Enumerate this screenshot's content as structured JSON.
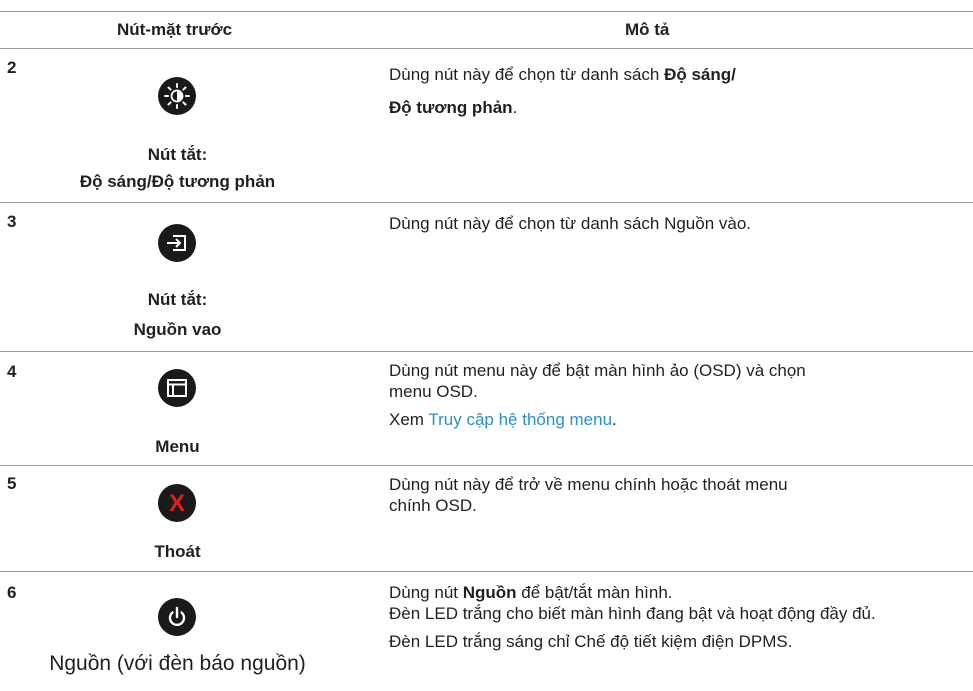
{
  "header": {
    "col1": "Nút-mặt trước",
    "col2": "Mô tả"
  },
  "rows": [
    {
      "num": "2",
      "icon": "brightness-contrast-icon",
      "caption1": "Nút tắt:",
      "caption2": "Độ sáng/Độ tương phản",
      "desc_pre": "Dùng nút này để chọn từ danh sách ",
      "desc_bold1": "Độ sáng/",
      "desc_bold2": "Độ tương phản",
      "desc_post": "."
    },
    {
      "num": "3",
      "icon": "input-source-icon",
      "caption1": "Nút tắt:",
      "caption2": "Nguồn vao",
      "desc": "Dùng nút này để chọn từ danh sách Nguồn vào."
    },
    {
      "num": "4",
      "icon": "menu-icon",
      "caption1": "Menu",
      "desc": "Dùng nút menu này để bật màn hình ảo (OSD) và chọn menu OSD.",
      "see_pre": "Xem ",
      "see_link": "Truy cập hệ thống menu",
      "see_post": "."
    },
    {
      "num": "5",
      "icon": "exit-icon",
      "caption1": "Thoát",
      "desc": "Dùng nút này để trở về menu chính hoặc thoát menu chính OSD."
    },
    {
      "num": "6",
      "icon": "power-icon",
      "caption1": "Nguồn (với đèn báo nguồn)",
      "desc_pre": "Dùng nút ",
      "desc_bold": "Nguồn",
      "desc_post": " để bật/tắt màn hình.",
      "desc2": "Đèn LED trắng cho biết màn hình đang bật và hoạt động đầy đủ.",
      "desc3": "Đèn LED trắng sáng chỉ Chế độ tiết kiệm điện DPMS."
    }
  ],
  "colors": {
    "link": "#2a8fd0",
    "icon_bg": "#1a1a1a",
    "exit_x": "#e0201b",
    "rule": "#9a9a9a"
  }
}
